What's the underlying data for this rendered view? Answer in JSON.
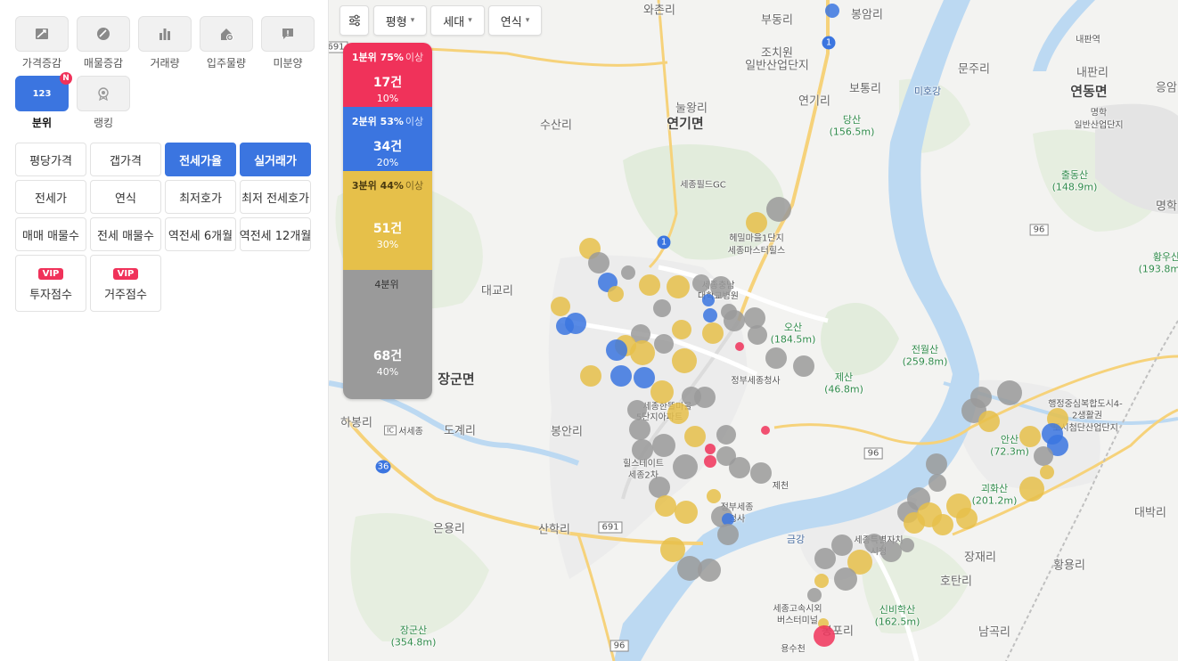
{
  "sidebar": {
    "categories": [
      {
        "label": "가격증감",
        "icon": "price-trend-icon"
      },
      {
        "label": "매물증감",
        "icon": "listing-trend-icon"
      },
      {
        "label": "거래량",
        "icon": "bar-chart-icon"
      },
      {
        "label": "입주물량",
        "icon": "house-plus-icon"
      },
      {
        "label": "미분양",
        "icon": "alert-message-icon"
      },
      {
        "label": "분위",
        "icon": "number-123-icon",
        "badge": "N",
        "icon_text": "123"
      },
      {
        "label": "랭킹",
        "icon": "medal-icon"
      }
    ],
    "options": [
      {
        "label": "평당가격",
        "active": false
      },
      {
        "label": "갭가격",
        "active": false
      },
      {
        "label": "전세가율",
        "active": true
      },
      {
        "label": "실거래가",
        "active": true
      },
      {
        "label": "전세가",
        "active": false
      },
      {
        "label": "연식",
        "active": false
      },
      {
        "label": "최저호가",
        "active": false
      },
      {
        "label": "최저 전세호가",
        "active": false
      },
      {
        "label": "매매 매물수",
        "active": false
      },
      {
        "label": "전세 매물수",
        "active": false
      },
      {
        "label": "역전세 6개월",
        "active": false
      },
      {
        "label": "역전세 12개월",
        "active": false
      }
    ],
    "vip_buttons": [
      {
        "tag": "VIP",
        "label": "투자점수"
      },
      {
        "tag": "VIP",
        "label": "거주점수"
      }
    ]
  },
  "toolbar": {
    "filter_icon": "sliders-icon",
    "dropdowns": [
      {
        "label": "평형"
      },
      {
        "label": "세대"
      },
      {
        "label": "연식"
      }
    ]
  },
  "legend": [
    {
      "head": "1분위 75%",
      "sub": "이상",
      "count": "17건",
      "percent": "10%",
      "color": "#f0325a"
    },
    {
      "head": "2분위 53%",
      "sub": "이상",
      "count": "34건",
      "percent": "20%",
      "color": "#3b75e0"
    },
    {
      "head": "3분위 44%",
      "sub": "이상",
      "count": "51건",
      "percent": "30%",
      "color": "#e6c04a"
    },
    {
      "head": "4분위",
      "sub": "",
      "count": "68건",
      "percent": "40%",
      "color": "#9a9a9a"
    }
  ],
  "map_labels": [
    {
      "text": "와촌리",
      "kind": "normal"
    },
    {
      "text": "부동리",
      "kind": "normal"
    },
    {
      "text": "봉암리",
      "kind": "normal"
    },
    {
      "text": "내판역",
      "kind": "small"
    },
    {
      "text": "조치원",
      "kind": "normal"
    },
    {
      "text": "일반산업단지",
      "kind": "normal"
    },
    {
      "text": "문주리",
      "kind": "normal"
    },
    {
      "text": "내판리",
      "kind": "normal"
    },
    {
      "text": "응암",
      "kind": "normal"
    },
    {
      "text": "보통리",
      "kind": "normal"
    },
    {
      "text": "미호강",
      "kind": "blue"
    },
    {
      "text": "연동면",
      "kind": "big"
    },
    {
      "text": "눌왕리",
      "kind": "normal"
    },
    {
      "text": "연기리",
      "kind": "normal"
    },
    {
      "text": "명학",
      "kind": "small"
    },
    {
      "text": "일반산업단지",
      "kind": "small"
    },
    {
      "text": "수산리",
      "kind": "normal"
    },
    {
      "text": "연기면",
      "kind": "big"
    },
    {
      "text": "당산",
      "kind": "green"
    },
    {
      "text": "(156.5m)",
      "kind": "green"
    },
    {
      "text": "출동산",
      "kind": "green"
    },
    {
      "text": "(148.9m)",
      "kind": "green"
    },
    {
      "text": "세종필드GC",
      "kind": "small"
    },
    {
      "text": "명학",
      "kind": "normal"
    },
    {
      "text": "헤밀마을1단지",
      "kind": "small"
    },
    {
      "text": "세종마스터힐스",
      "kind": "small"
    },
    {
      "text": "황우산",
      "kind": "green"
    },
    {
      "text": "(193.8m)",
      "kind": "green"
    },
    {
      "text": "대교리",
      "kind": "normal"
    },
    {
      "text": "세종충남",
      "kind": "small"
    },
    {
      "text": "대학교병원",
      "kind": "small"
    },
    {
      "text": "오산",
      "kind": "green"
    },
    {
      "text": "(184.5m)",
      "kind": "green"
    },
    {
      "text": "전월산",
      "kind": "green"
    },
    {
      "text": "(259.8m)",
      "kind": "green"
    },
    {
      "text": "제산",
      "kind": "green"
    },
    {
      "text": "(46.8m)",
      "kind": "green"
    },
    {
      "text": "정부세종청사",
      "kind": "small"
    },
    {
      "text": "장군면",
      "kind": "big"
    },
    {
      "text": "세종한뜰마을",
      "kind": "small"
    },
    {
      "text": "5단지아파트",
      "kind": "small"
    },
    {
      "text": "행정중심복합도시4-",
      "kind": "small"
    },
    {
      "text": "2생활권",
      "kind": "small"
    },
    {
      "text": "도시첨단산업단지",
      "kind": "small"
    },
    {
      "text": "하봉리",
      "kind": "normal"
    },
    {
      "text": "도계리",
      "kind": "normal"
    },
    {
      "text": "봉안리",
      "kind": "normal"
    },
    {
      "text": "서세종",
      "kind": "small"
    },
    {
      "text": "안산",
      "kind": "green"
    },
    {
      "text": "(72.3m)",
      "kind": "green"
    },
    {
      "text": "힐스테이트",
      "kind": "small"
    },
    {
      "text": "세종2차",
      "kind": "small"
    },
    {
      "text": "제천",
      "kind": "small"
    },
    {
      "text": "괴화산",
      "kind": "green"
    },
    {
      "text": "(201.2m)",
      "kind": "green"
    },
    {
      "text": "정부세종",
      "kind": "small"
    },
    {
      "text": "청사",
      "kind": "small"
    },
    {
      "text": "대박리",
      "kind": "normal"
    },
    {
      "text": "은용리",
      "kind": "normal"
    },
    {
      "text": "산학리",
      "kind": "normal"
    },
    {
      "text": "금강",
      "kind": "blue"
    },
    {
      "text": "세종특별자치",
      "kind": "small"
    },
    {
      "text": "시청",
      "kind": "small"
    },
    {
      "text": "장재리",
      "kind": "normal"
    },
    {
      "text": "황용리",
      "kind": "normal"
    },
    {
      "text": "호탄리",
      "kind": "normal"
    },
    {
      "text": "세종고속시외",
      "kind": "small"
    },
    {
      "text": "버스터미널",
      "kind": "small"
    },
    {
      "text": "신비학산",
      "kind": "green"
    },
    {
      "text": "(162.5m)",
      "kind": "green"
    },
    {
      "text": "장군산",
      "kind": "green"
    },
    {
      "text": "(354.8m)",
      "kind": "green"
    },
    {
      "text": "봉포리",
      "kind": "normal"
    },
    {
      "text": "남곡리",
      "kind": "normal"
    },
    {
      "text": "용수천",
      "kind": "small"
    },
    {
      "text": "1",
      "kind": "shield"
    },
    {
      "text": "1",
      "kind": "shield"
    },
    {
      "text": "96",
      "kind": "road"
    },
    {
      "text": "96",
      "kind": "road"
    },
    {
      "text": "96",
      "kind": "road"
    },
    {
      "text": "691",
      "kind": "road"
    },
    {
      "text": "691",
      "kind": "road"
    },
    {
      "text": "36",
      "kind": "shield"
    },
    {
      "text": "IC",
      "kind": "road"
    }
  ]
}
